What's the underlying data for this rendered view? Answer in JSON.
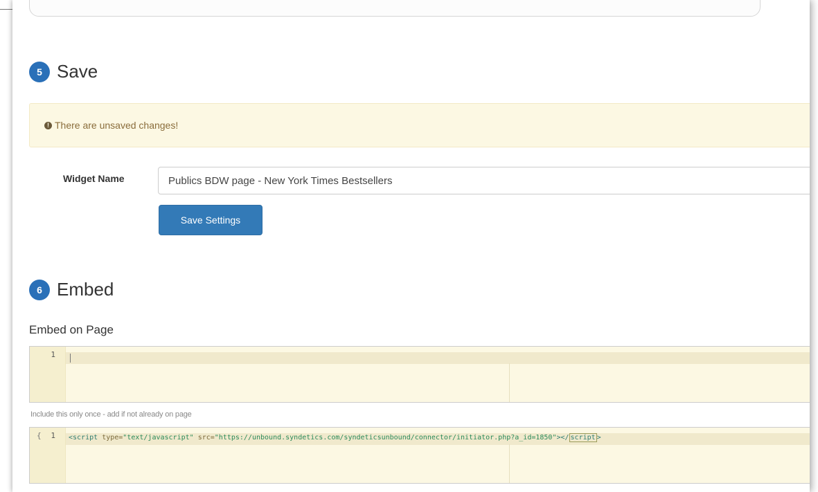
{
  "save_section": {
    "step_number": "5",
    "title": "Save",
    "alert_text": "There are unsaved changes!",
    "alert_icon": "exclamation-circle-icon",
    "widget_name_label": "Widget Name",
    "widget_name_value": "Publics BDW page - New York Times Bestsellers",
    "save_button_label": "Save Settings"
  },
  "embed_section": {
    "step_number": "6",
    "title": "Embed",
    "embed_label": "Embed on Page",
    "editor1": {
      "line_number": "1",
      "content": ""
    },
    "hint": "Include this only once - add if not already on page",
    "editor2": {
      "fold_marker": "{",
      "line_number": "1",
      "tag_open": "<script",
      "attr_type": "type=",
      "val_type": "\"text/javascript\"",
      "attr_src": "src=",
      "val_src": "\"https://unbound.syndetics.com/syndeticsunbound/connector/initiator.php?a_id=1850\"",
      "tag_mid": "></",
      "tag_close_name": "script",
      "tag_end": ">"
    }
  },
  "colors": {
    "accent": "#337ab7",
    "badge": "#2a70b8",
    "alert_bg": "#fcf8e3",
    "alert_text": "#8a6d3b"
  }
}
